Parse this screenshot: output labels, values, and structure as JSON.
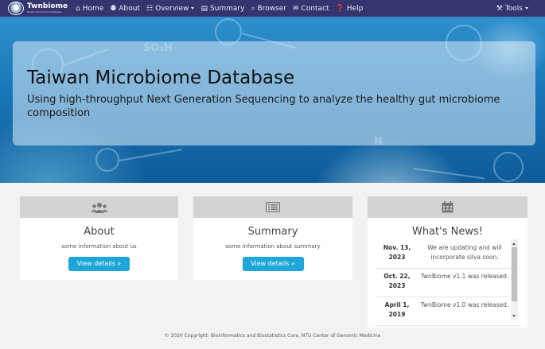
{
  "brand": {
    "title": "Twnbiome",
    "subtitle": "Taiwan Microbiome Database"
  },
  "nav": {
    "items": [
      {
        "label": "Home",
        "icon": "home-icon",
        "glyph": "⌂"
      },
      {
        "label": "About",
        "icon": "users-icon",
        "glyph": "⚉"
      },
      {
        "label": "Overview",
        "icon": "chart-icon",
        "glyph": "☷",
        "dropdown": true
      },
      {
        "label": "Summary",
        "icon": "list-icon",
        "glyph": "▤"
      },
      {
        "label": "Browser",
        "icon": "search-icon",
        "glyph": "⌕"
      },
      {
        "label": "Contact",
        "icon": "envelope-icon",
        "glyph": "✉"
      },
      {
        "label": "Help",
        "icon": "question-circle-icon",
        "glyph": "❓"
      }
    ],
    "tools": {
      "label": "Tools",
      "icon": "tools-icon",
      "glyph": "⚒"
    }
  },
  "hero": {
    "title": "Taiwan Microbiome Database",
    "subtitle": "Using high-throughput Next Generation Sequencing to analyze the healthy gut microbiome composition"
  },
  "cards": {
    "about": {
      "icon": "users-icon",
      "title": "About",
      "desc": "some information about us",
      "button": "View details »"
    },
    "summary": {
      "icon": "list-alt-icon",
      "title": "Summary",
      "desc": "some information about summary",
      "button": "View details »"
    },
    "news": {
      "icon": "calendar-icon",
      "title": "What's News!",
      "items": [
        {
          "date": "Nov. 13, 2023",
          "text": "We are updating and will incorporate silva soon."
        },
        {
          "date": "Oct. 22, 2023",
          "text": "TwnBiome v1.1 was released."
        },
        {
          "date": "April 1, 2019",
          "text": "TwnBiome v1.0 was released."
        }
      ]
    }
  },
  "footer": {
    "text": "© 2020 Copyright: Bioinformatics and Biostatistics Core, NTU Center of Genomic Medicine"
  },
  "colors": {
    "navbar": "#34346e",
    "button": "#1ea6d8",
    "card_head": "#d3d3d3",
    "page_bg": "#f2f2f2"
  }
}
